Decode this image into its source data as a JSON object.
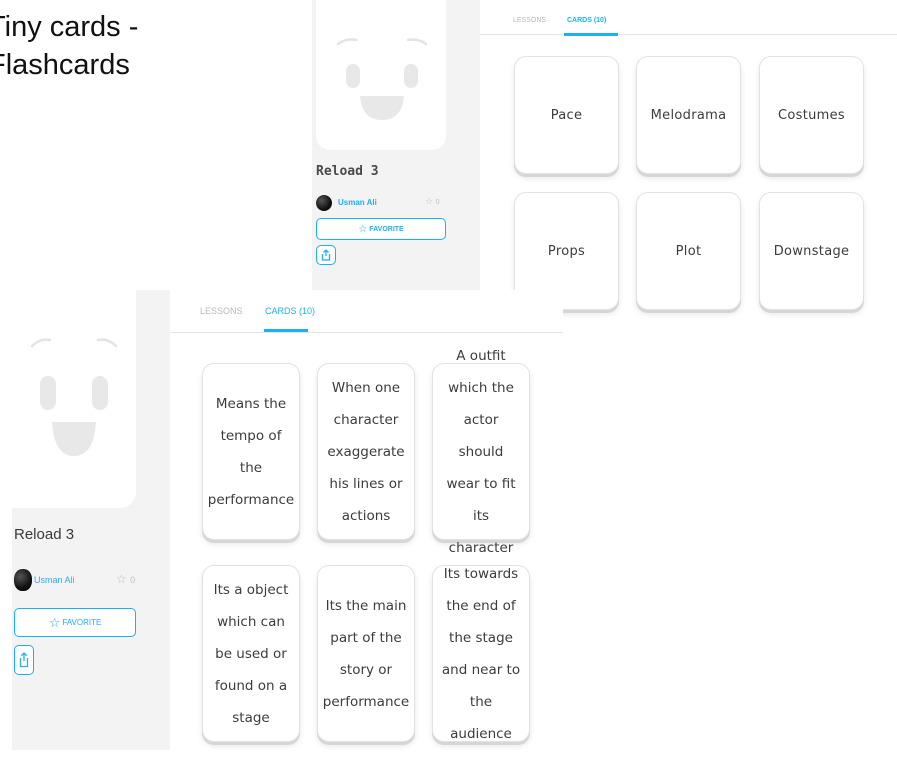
{
  "slide": {
    "title_line1": "Tiny cards -",
    "title_line2": "Flashcards"
  },
  "top_panel": {
    "deck_name": "Reload 3",
    "author": "Usman Ali",
    "stars": "0",
    "favorite_label": "FAVORITE",
    "tabs": [
      {
        "label": "LESSONS",
        "active": false
      },
      {
        "label": "CARDS (10)",
        "active": true
      }
    ],
    "cards": [
      {
        "text": "Pace"
      },
      {
        "text": "Melodrama"
      },
      {
        "text": "Costumes"
      },
      {
        "text": "Props"
      },
      {
        "text": "Plot"
      },
      {
        "text": "Downstage"
      }
    ]
  },
  "bottom_panel": {
    "deck_name": "Reload 3",
    "author": "Usman Ali",
    "stars": "0",
    "favorite_label": "FAVORITE",
    "tabs": [
      {
        "label": "LESSONS",
        "active": false
      },
      {
        "label": "CARDS (10)",
        "active": true
      }
    ],
    "cards": [
      {
        "text": "Means the tempo of the performance"
      },
      {
        "text": "When one character exaggerate his lines or actions"
      },
      {
        "text": "A outfit which the actor should wear to fit its character"
      },
      {
        "text": "Its a object which can be used or found on a stage"
      },
      {
        "text": "Its the main part of the story or performance"
      },
      {
        "text": "Its towards the end of the stage and near to the audience"
      }
    ]
  },
  "icons": {
    "star": "star-outline-icon",
    "share": "share-icon",
    "face": "smiley-face-icon"
  },
  "colors": {
    "accent": "#1cb0f6",
    "sidebar_bg": "#f3f3f3",
    "card_text": "#3c3c3c"
  }
}
